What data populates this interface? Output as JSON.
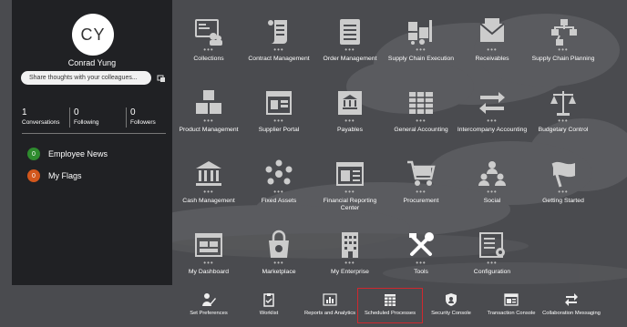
{
  "profile": {
    "initials": "CY",
    "name": "Conrad Yung",
    "share_placeholder": "Share thoughts with your colleagues...",
    "stats": [
      {
        "value": "1",
        "label": "Conversations"
      },
      {
        "value": "0",
        "label": "Following"
      },
      {
        "value": "0",
        "label": "Followers"
      }
    ],
    "badges": [
      {
        "count": "0",
        "label": "Employee News",
        "color": "#2e8b2e"
      },
      {
        "count": "0",
        "label": "My Flags",
        "color": "#d2571c"
      }
    ]
  },
  "tiles": [
    {
      "label": "Collections",
      "icon": "collections-icon"
    },
    {
      "label": "Contract Management",
      "icon": "contract-scroll-icon"
    },
    {
      "label": "Order Management",
      "icon": "order-list-icon"
    },
    {
      "label": "Supply Chain Execution",
      "icon": "forklift-icon"
    },
    {
      "label": "Receivables",
      "icon": "envelope-icon"
    },
    {
      "label": "Supply Chain Planning",
      "icon": "flow-diagram-icon"
    },
    {
      "label": "Product Management",
      "icon": "boxes-icon"
    },
    {
      "label": "Supplier Portal",
      "icon": "portal-window-icon"
    },
    {
      "label": "Payables",
      "icon": "bank-ledger-icon"
    },
    {
      "label": "General Accounting",
      "icon": "spreadsheet-icon"
    },
    {
      "label": "Intercompany Accounting",
      "icon": "transfer-arrows-icon"
    },
    {
      "label": "Budgetary Control",
      "icon": "balance-scale-icon"
    },
    {
      "label": "Cash Management",
      "icon": "bank-building-icon"
    },
    {
      "label": "Fixed Assets",
      "icon": "asset-cycle-icon"
    },
    {
      "label": "Financial Reporting Center",
      "icon": "report-window-icon"
    },
    {
      "label": "Procurement",
      "icon": "shopping-cart-icon"
    },
    {
      "label": "Social",
      "icon": "people-network-icon"
    },
    {
      "label": "Getting Started",
      "icon": "flag-icon"
    },
    {
      "label": "My Dashboard",
      "icon": "dashboard-icon"
    },
    {
      "label": "Marketplace",
      "icon": "shopping-bag-icon"
    },
    {
      "label": "My Enterprise",
      "icon": "office-building-icon"
    },
    {
      "label": "Tools",
      "icon": "tools-icon"
    },
    {
      "label": "Configuration",
      "icon": "configuration-icon"
    }
  ],
  "dock": [
    {
      "label": "Set Preferences",
      "icon": "person-pencil-icon"
    },
    {
      "label": "Worklist",
      "icon": "clipboard-check-icon"
    },
    {
      "label": "Reports and Analytics",
      "icon": "bar-chart-icon"
    },
    {
      "label": "Scheduled Processes",
      "icon": "calendar-grid-icon"
    },
    {
      "label": "Security Console",
      "icon": "shield-icon"
    },
    {
      "label": "Transaction Console",
      "icon": "console-window-icon"
    },
    {
      "label": "Collaboration Messaging",
      "icon": "swap-arrows-icon"
    }
  ],
  "colors": {
    "selected_border": "#d0282e",
    "background": "#4a4b4f",
    "panel": "#202124"
  }
}
